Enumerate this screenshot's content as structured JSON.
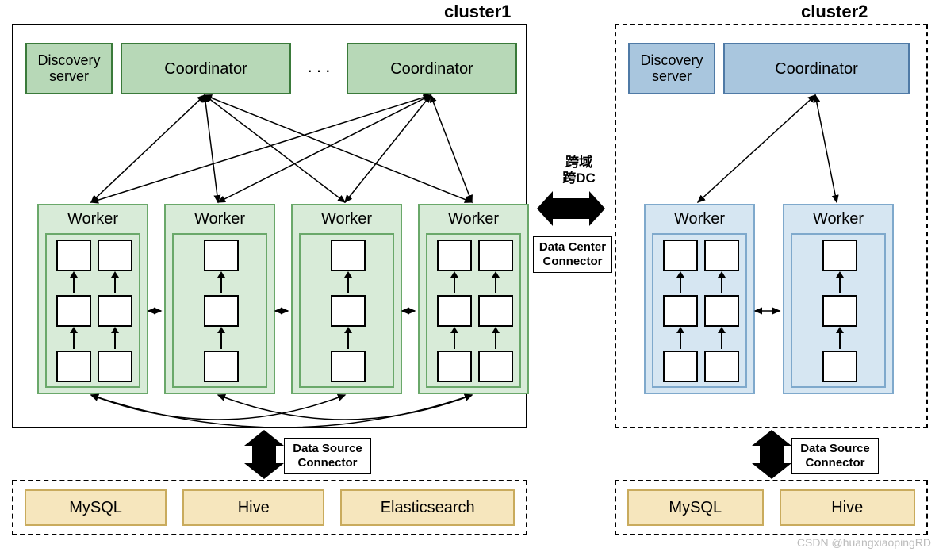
{
  "labels": {
    "cluster1": "cluster1",
    "cluster2": "cluster2",
    "discovery": "Discovery\nserver",
    "coordinator": "Coordinator",
    "ellipsis": "···",
    "worker": "Worker",
    "cross_line1": "跨域",
    "cross_line2": "跨DC",
    "dc_connector_l1": "Data Center",
    "dc_connector_l2": "Connector",
    "ds_connector_l1": "Data Source",
    "ds_connector_l2": "Connector",
    "mysql": "MySQL",
    "hive": "Hive",
    "es": "Elasticsearch",
    "watermark": "CSDN @huangxiaopingRD"
  },
  "colors": {
    "green_fill": "#b7d8b7",
    "green_border": "#3a7a3a",
    "lightgreen_fill": "#d8ebd8",
    "blue_fill": "#a9c6de",
    "blue_border": "#4f7aa6",
    "lightblue_fill": "#d6e6f2",
    "tan_fill": "#f6e6bd",
    "tan_border": "#c9ab5d"
  }
}
